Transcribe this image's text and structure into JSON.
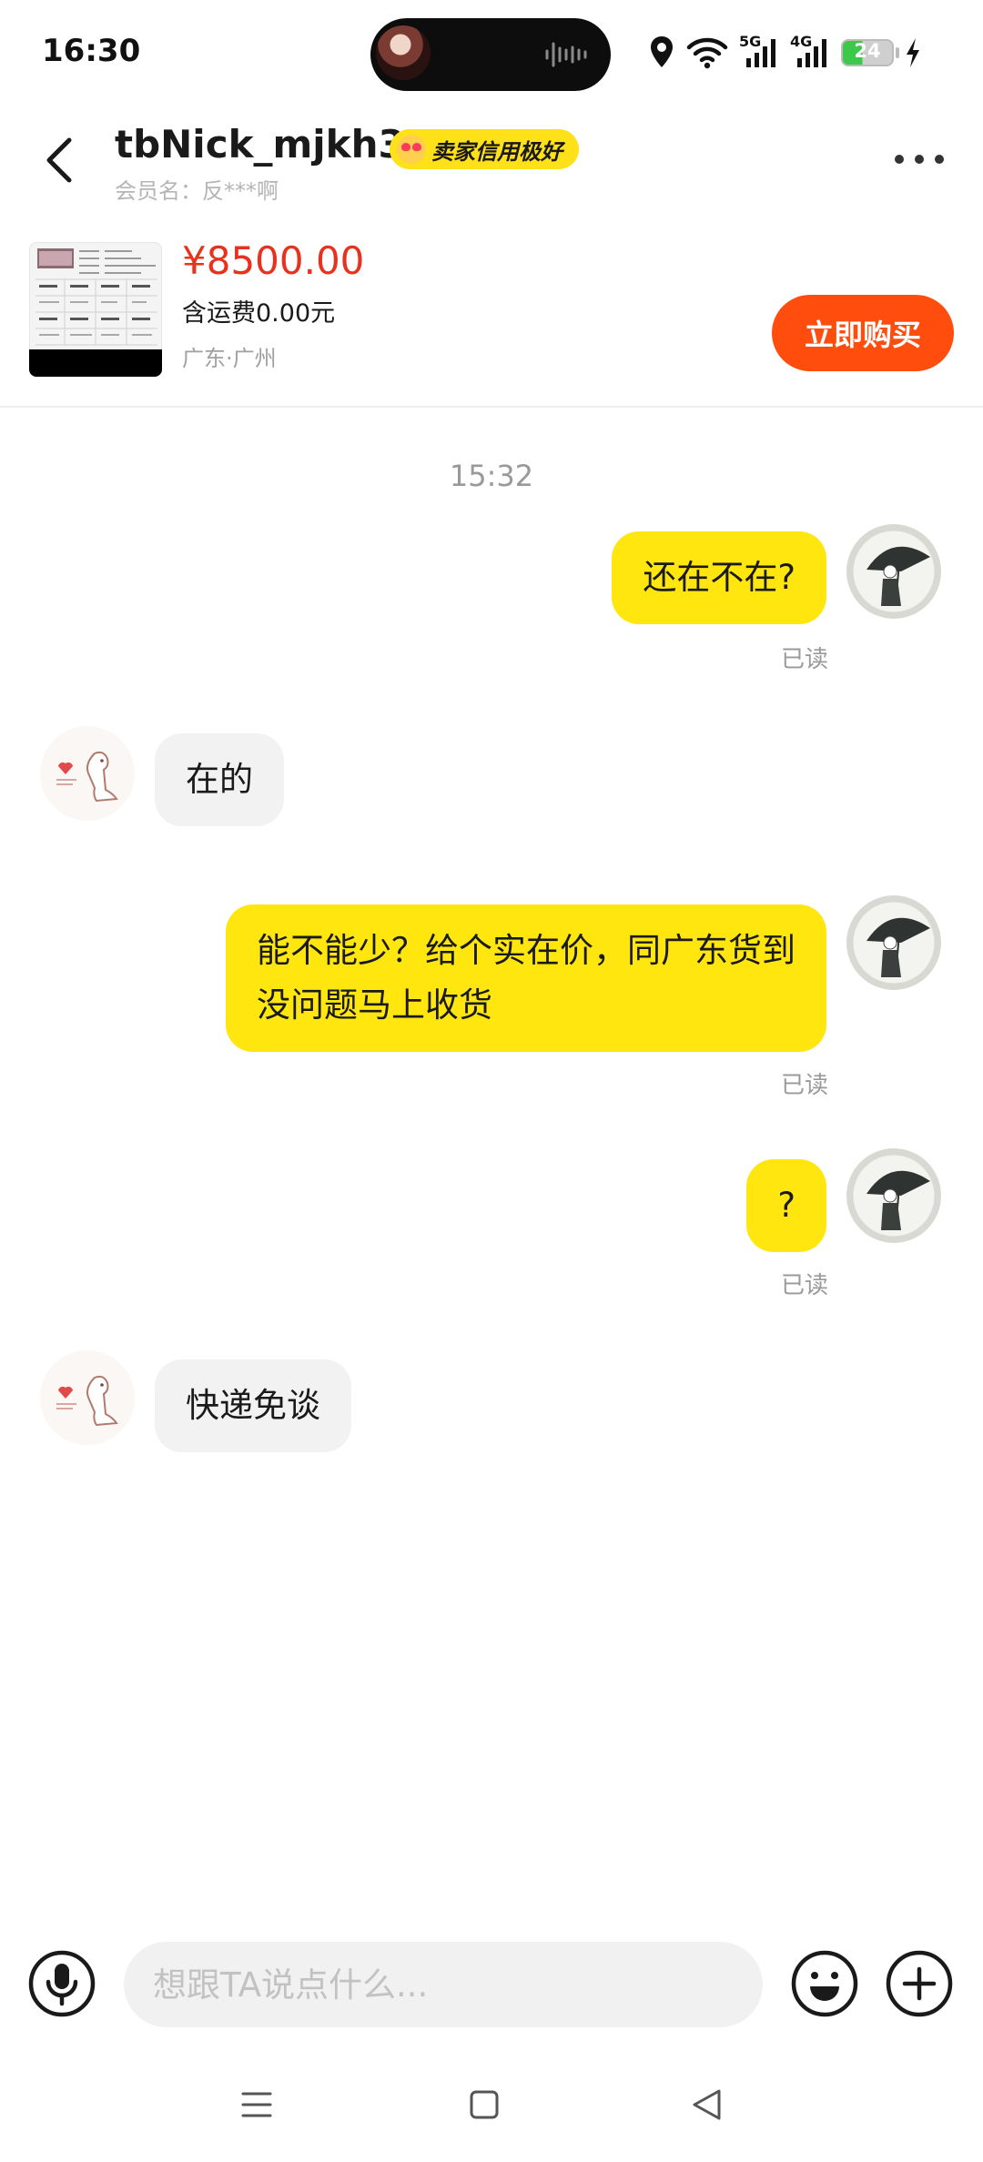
{
  "status_bar": {
    "time": "16:30",
    "battery": "24",
    "network_1": "5G",
    "network_2": "4G"
  },
  "header": {
    "nickname": "tbNick_mjkh3",
    "credit_badge": "卖家信用极好",
    "member_name": "会员名：反***啊"
  },
  "product": {
    "price": "¥8500.00",
    "shipping": "含运费0.00元",
    "location": "广东·广州",
    "buy_label": "立即购买"
  },
  "chat": {
    "timestamp": "15:32",
    "messages": [
      {
        "from": "me",
        "text": "还在不在?",
        "status": "已读"
      },
      {
        "from": "seller",
        "text": "在的"
      },
      {
        "from": "me",
        "line1": "能不能少？给个实在价，同广东货到",
        "line2": "没问题马上收货",
        "status": "已读"
      },
      {
        "from": "me",
        "text": "?",
        "status": "已读"
      },
      {
        "from": "seller",
        "text": "快递免谈"
      }
    ]
  },
  "input": {
    "placeholder": "想跟TA说点什么..."
  },
  "colors": {
    "accent_yellow": "#ffe60f",
    "buy_orange": "#ff4d0e",
    "price_red": "#e8321e"
  },
  "icons": {
    "back": "chevron-left-icon",
    "more": "more-dots-icon",
    "mic": "microphone-icon",
    "emoji": "smiley-icon",
    "plus": "plus-icon"
  }
}
